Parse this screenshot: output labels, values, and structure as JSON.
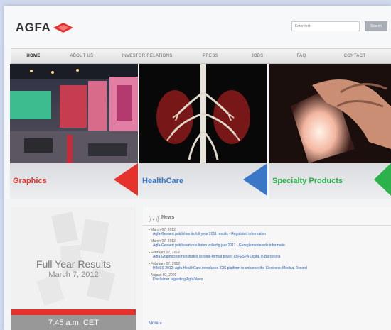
{
  "brand": {
    "name": "AGFA",
    "accent": "#e5322d"
  },
  "search": {
    "placeholder": "Enter text",
    "button": "Search"
  },
  "nav": {
    "items": [
      "HOME",
      "ABOUT US",
      "INVESTOR RELATIONS",
      "PRESS",
      "JOBS",
      "FAQ",
      "CONTACT"
    ],
    "active": "HOME"
  },
  "panels": [
    {
      "label": "Graphics",
      "color": "#e5322d"
    },
    {
      "label": "HealthCare",
      "color": "#3a78c7"
    },
    {
      "label": "Specialty Products",
      "color": "#2bb24a"
    }
  ],
  "promo": {
    "title": "Full Year Results",
    "date": "March 7, 2012",
    "time": "7.45 a.m. CET"
  },
  "news": {
    "title": "News",
    "items": [
      {
        "date": "March 07, 2012",
        "text": "Agfa-Gevaert publishes its full year 2011 results - Regulated information"
      },
      {
        "date": "March 07, 2012",
        "text": "Agfa-Gevaert publiceert resultaten volledig jaar 2011 - Gereglementeerde informatie"
      },
      {
        "date": "February 07, 2012",
        "text": "Agfa Graphics demonstrates its wide-format power at FESPA Digital in Barcelona"
      },
      {
        "date": "February 07, 2012",
        "text": "HIMSS 2012: Agfa HealthCare introduces ICIS platform to enhance the Electronic Medical Record"
      },
      {
        "date": "August 07, 2009",
        "text": "Disclaimer regarding Agfa/Novo"
      }
    ],
    "more": "More"
  }
}
